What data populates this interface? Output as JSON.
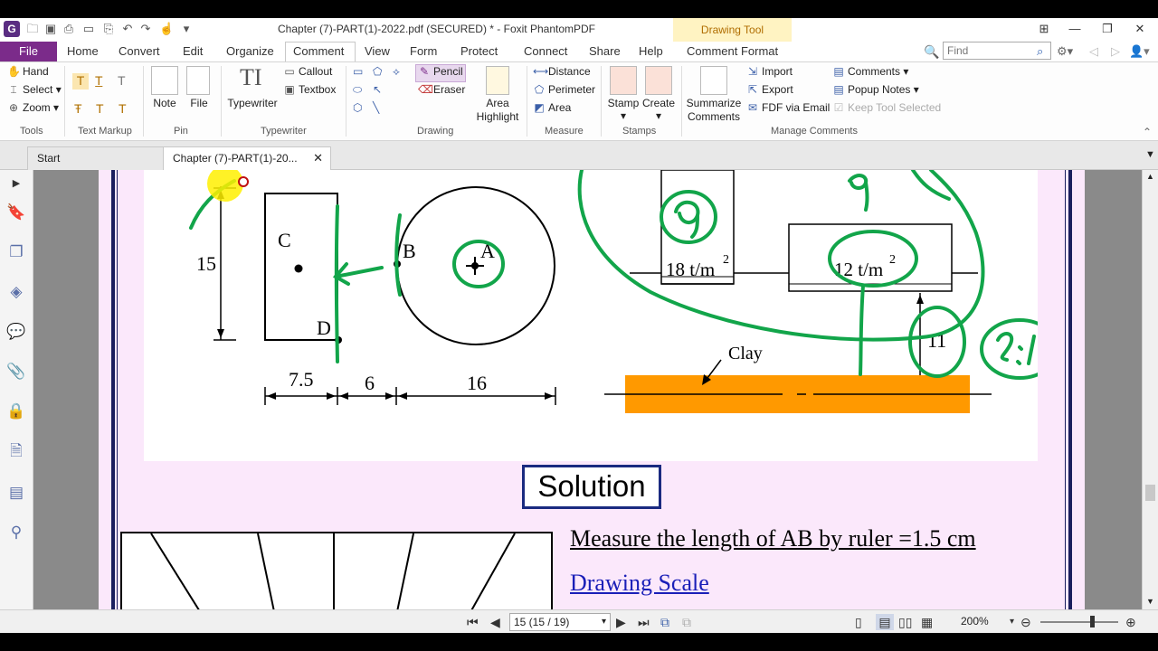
{
  "window": {
    "title": "Chapter (7)-PART(1)-2022.pdf (SECURED) * - Foxit PhantomPDF",
    "context_tab": "Drawing Tool"
  },
  "menu": {
    "file": "File",
    "tabs": [
      "Home",
      "Convert",
      "Edit",
      "Organize",
      "Comment",
      "View",
      "Form",
      "Protect",
      "Connect",
      "Share",
      "Help",
      "Comment Format"
    ],
    "active": "Comment",
    "find_placeholder": "Find"
  },
  "ribbon": {
    "tools": {
      "label": "Tools",
      "hand": "Hand",
      "select": "Select",
      "zoom": "Zoom"
    },
    "text_markup": {
      "label": "Text Markup"
    },
    "pin": {
      "label": "Pin",
      "note": "Note",
      "file": "File"
    },
    "typewriter": {
      "label": "Typewriter",
      "typewriter": "Typewriter",
      "callout": "Callout",
      "textbox": "Textbox"
    },
    "drawing": {
      "label": "Drawing",
      "pencil": "Pencil",
      "eraser": "Eraser",
      "area_highlight_1": "Area",
      "area_highlight_2": "Highlight"
    },
    "measure": {
      "label": "Measure",
      "distance": "Distance",
      "perimeter": "Perimeter",
      "area": "Area"
    },
    "stamps": {
      "label": "Stamps",
      "stamp": "Stamp",
      "create": "Create"
    },
    "manage": {
      "label": "Manage Comments",
      "summarize_1": "Summarize",
      "summarize_2": "Comments",
      "import": "Import",
      "export": "Export",
      "fdf_email": "FDF via Email",
      "comments": "Comments",
      "popup_notes": "Popup Notes",
      "keep_tool": "Keep Tool Selected"
    }
  },
  "doc_tabs": {
    "start": "Start",
    "chapter": "Chapter (7)-PART(1)-20..."
  },
  "page": {
    "figure": {
      "dim_15": "15",
      "label_c": "C",
      "label_d": "D",
      "label_b": "B",
      "label_a": "A",
      "dim_7_5": "7.5",
      "dim_6": "6",
      "dim_16": "16",
      "load_1_value": "18 t/m",
      "load_2_value": "12 t/m",
      "sup": "2",
      "dim_11": "11",
      "clay": "Clay"
    },
    "solution_title": "Solution",
    "measure_text": "Measure the length of AB by ruler =1.5 cm",
    "scale_link": "Drawing Scale"
  },
  "status": {
    "page_field": "15 (15 / 19)",
    "zoom": "200%"
  },
  "colors": {
    "brand": "#7b2b8a",
    "ink_green": "#12a54a",
    "clay_orange": "#ff9900",
    "page_pink": "#fbe8fb",
    "border_navy": "#1a1f5e",
    "link_blue": "#1a1fb8"
  }
}
